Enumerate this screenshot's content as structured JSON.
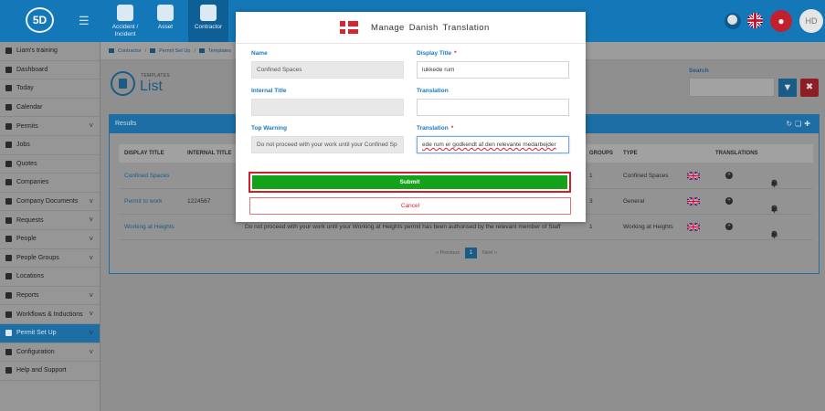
{
  "topbar": {
    "logo_text": "5D",
    "modules": [
      {
        "label": "Accident / Incident",
        "icon": "first-aid-icon"
      },
      {
        "label": "Asset",
        "icon": "asset-icon"
      },
      {
        "label": "Contractor",
        "icon": "hardhat-icon"
      }
    ],
    "avatar_initials": "HD"
  },
  "sidebar": {
    "items": [
      {
        "label": "Liam's training",
        "icon": "training-icon",
        "chevron": false
      },
      {
        "label": "Dashboard",
        "icon": "dashboard-icon",
        "chevron": false
      },
      {
        "label": "Today",
        "icon": "today-icon",
        "chevron": false
      },
      {
        "label": "Calendar",
        "icon": "calendar-icon",
        "chevron": false
      },
      {
        "label": "Permits",
        "icon": "permits-icon",
        "chevron": true
      },
      {
        "label": "Jobs",
        "icon": "jobs-icon",
        "chevron": false
      },
      {
        "label": "Quotes",
        "icon": "quotes-icon",
        "chevron": false
      },
      {
        "label": "Companies",
        "icon": "companies-icon",
        "chevron": false
      },
      {
        "label": "Company Documents",
        "icon": "documents-icon",
        "chevron": true
      },
      {
        "label": "Requests",
        "icon": "requests-icon",
        "chevron": true
      },
      {
        "label": "People",
        "icon": "people-icon",
        "chevron": true
      },
      {
        "label": "People Groups",
        "icon": "people-groups-icon",
        "chevron": true
      },
      {
        "label": "Locations",
        "icon": "locations-icon",
        "chevron": false
      },
      {
        "label": "Reports",
        "icon": "reports-icon",
        "chevron": true
      },
      {
        "label": "Workflows & Inductions",
        "icon": "workflows-icon",
        "chevron": true
      },
      {
        "label": "Permit Set Up",
        "icon": "permit-setup-icon",
        "chevron": true,
        "active": true
      },
      {
        "label": "Configuration",
        "icon": "configuration-icon",
        "chevron": true
      },
      {
        "label": "Help and Support",
        "icon": "help-icon",
        "chevron": false
      }
    ]
  },
  "breadcrumb": {
    "items": [
      "Contractor",
      "Permit Set Up",
      "Templates"
    ]
  },
  "page": {
    "kicker": "TEMPLATES",
    "title": "List",
    "search_label": "Search",
    "search_value": ""
  },
  "results": {
    "title": "Results",
    "columns": {
      "display_title": "DISPLAY TITLE",
      "internal_title": "INTERNAL TITLE",
      "groups": "GROUPS",
      "type": "TYPE",
      "translations": "TRANSLATIONS"
    },
    "rows": [
      {
        "display_title": "Confined Spaces",
        "internal_title": "",
        "warning": "",
        "groups": "1",
        "type": "Confined Spaces"
      },
      {
        "display_title": "Permit to work",
        "internal_title": "1224567",
        "warning": "",
        "groups": "3",
        "type": "General"
      },
      {
        "display_title": "Working at Heights",
        "internal_title": "",
        "warning": "Do not proceed with your work until your Working at Heights permit has been authorised by the relevant member of Staff",
        "groups": "1",
        "type": "Working at Heights"
      }
    ],
    "pager": {
      "previous": "« Previous",
      "current": "1",
      "next": "Next »"
    }
  },
  "modal": {
    "title": "Manage  Danish  Translation",
    "name_label": "Name",
    "name_value": "Confined Spaces",
    "display_title_label": "Display Title",
    "display_title_value": "lukkede rum",
    "internal_title_label": "Internal Title",
    "internal_title_value": "",
    "translation_label": "Translation",
    "translation_value": "",
    "top_warning_label": "Top Warning",
    "top_warning_value": "Do not proceed with your work until your Confined Sp",
    "translation2_label": "Translation",
    "translation2_value": "ede rum er godkendt af den relevante medarbejder",
    "required_mark": "*",
    "submit_label": "Submit",
    "cancel_label": "Cancel"
  },
  "colors": {
    "brand_blue": "#1478b8",
    "submit_green": "#15a21b",
    "danger_red": "#d01f2b",
    "label_blue": "#1a7bbf"
  }
}
